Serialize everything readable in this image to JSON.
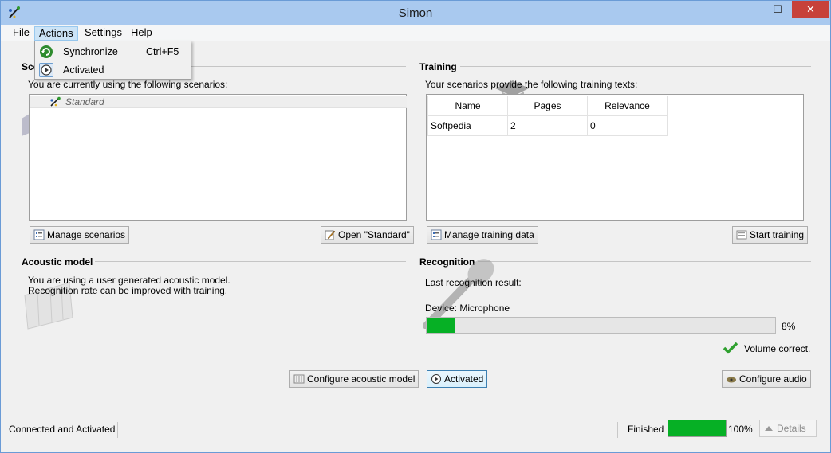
{
  "window": {
    "title": "Simon",
    "minimize": "—",
    "maximize": "☐",
    "close": "✕"
  },
  "menu": {
    "items": [
      "File",
      "Actions",
      "Settings",
      "Help"
    ],
    "dropdown": [
      {
        "label": "Synchronize",
        "shortcut": "Ctrl+F5",
        "icon": "sync-icon"
      },
      {
        "label": "Activated",
        "shortcut": "",
        "icon": "play-icon"
      }
    ]
  },
  "scenarios": {
    "title": "Scenarios",
    "description": "You are currently using the following scenarios:",
    "items": [
      "Standard"
    ],
    "manage_button": "Manage scenarios",
    "open_button": "Open \"Standard\""
  },
  "training": {
    "title": "Training",
    "description": "Your scenarios provide the following training texts:",
    "columns": [
      "Name",
      "Pages",
      "Relevance"
    ],
    "rows": [
      [
        "Softpedia",
        "2",
        "0"
      ]
    ],
    "manage_button": "Manage training data",
    "start_button": "Start training"
  },
  "acoustic": {
    "title": "Acoustic model",
    "line1": "You are using a user generated acoustic model.",
    "line2": "Recognition rate can be improved with training.",
    "configure_button": "Configure acoustic model"
  },
  "recognition": {
    "title": "Recognition",
    "last_result_label": "Last recognition result:",
    "device_label": "Device: Microphone",
    "volume_percent": 8,
    "volume_text": "8%",
    "volume_status": "Volume correct.",
    "activated_button": "Activated",
    "configure_audio_button": "Configure audio"
  },
  "statusbar": {
    "status": "Connected and Activated",
    "progress_label": "Finished",
    "progress_percent": 100,
    "progress_text": "100%",
    "details_button": "Details"
  },
  "colors": {
    "accent": "#06b025",
    "titlebar": "#a9c9ef",
    "close": "#c7413a"
  }
}
